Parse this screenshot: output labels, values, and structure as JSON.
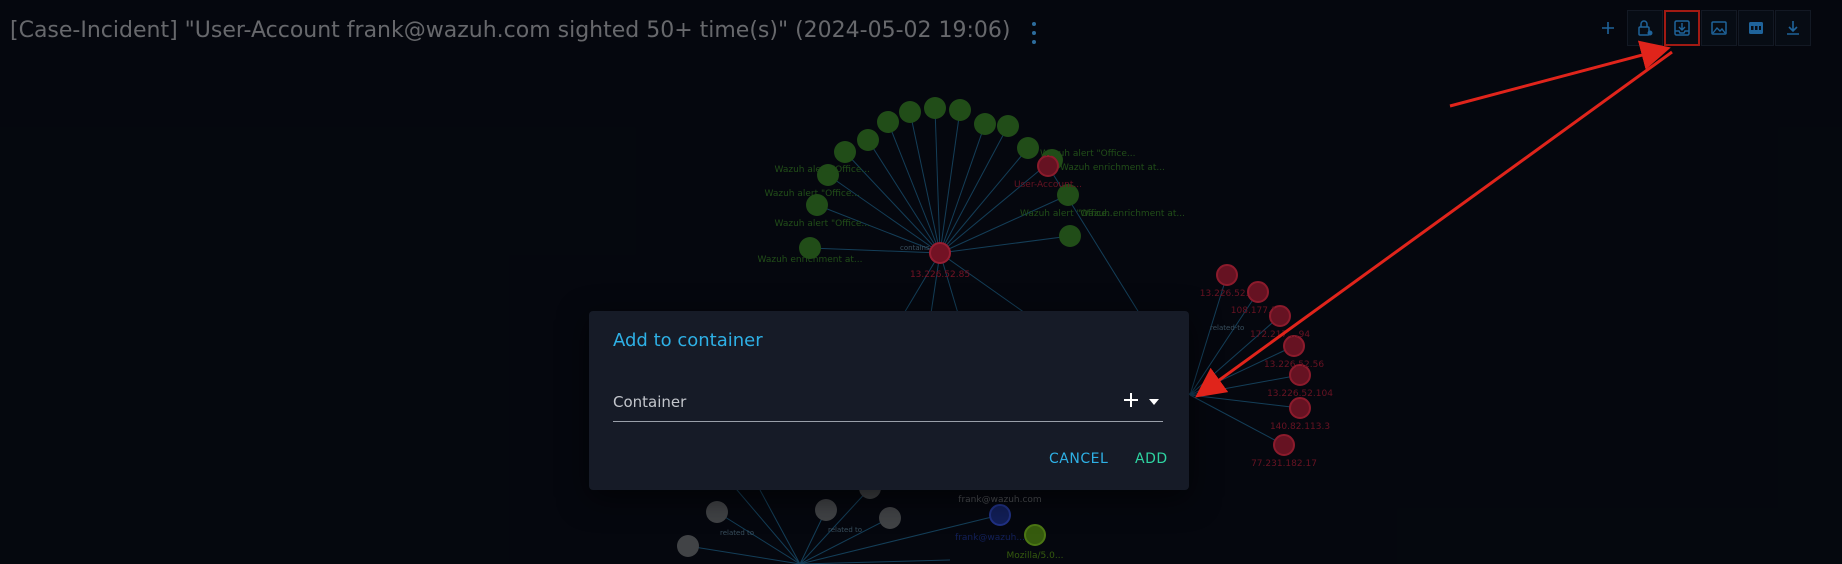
{
  "header": {
    "title": "[Case-Incident] \"User-Account frank@wazuh.com sighted 50+ time(s)\" (2024-05-02 19:06)"
  },
  "toolbar": {
    "buttons": [
      {
        "name": "add-icon",
        "highlighted": false
      },
      {
        "name": "lock-settings-icon",
        "highlighted": false
      },
      {
        "name": "add-to-container-icon",
        "highlighted": true
      },
      {
        "name": "image-export-icon",
        "highlighted": false
      },
      {
        "name": "pdf-export-icon",
        "highlighted": false
      },
      {
        "name": "download-icon",
        "highlighted": false
      }
    ]
  },
  "dialog": {
    "title": "Add to container",
    "field_label": "Container",
    "cancel_label": "CANCEL",
    "add_label": "ADD"
  },
  "graph": {
    "center_label": "13.226.52.85",
    "green_labels": [
      "Wazuh enrichment at...",
      "Wazuh alert \"Office...",
      "Wazuh alert \"Office...",
      "Wazuh alert \"Office...",
      "Wazuh enrichment at...",
      "Wazuh alert \"Office...",
      "Wazuh enrichment at...",
      "Wazuh alert \"Office..."
    ],
    "red_labels": [
      "User-Account...",
      "13.226.52...",
      "108.177.1...",
      "172.217....94",
      "13.226.52.56",
      "13.226.52.104",
      "140.82.113.3",
      "77.231.182.17"
    ],
    "edge_labels": [
      "contains",
      "related-to",
      "related to"
    ],
    "bottom_labels": [
      "frank@wazuh.com",
      "frank@wazuh...",
      "Mozilla/5.0..."
    ]
  },
  "colors": {
    "background": "#070b14",
    "accent": "#2eb0e5",
    "highlight": "#e0241b"
  }
}
